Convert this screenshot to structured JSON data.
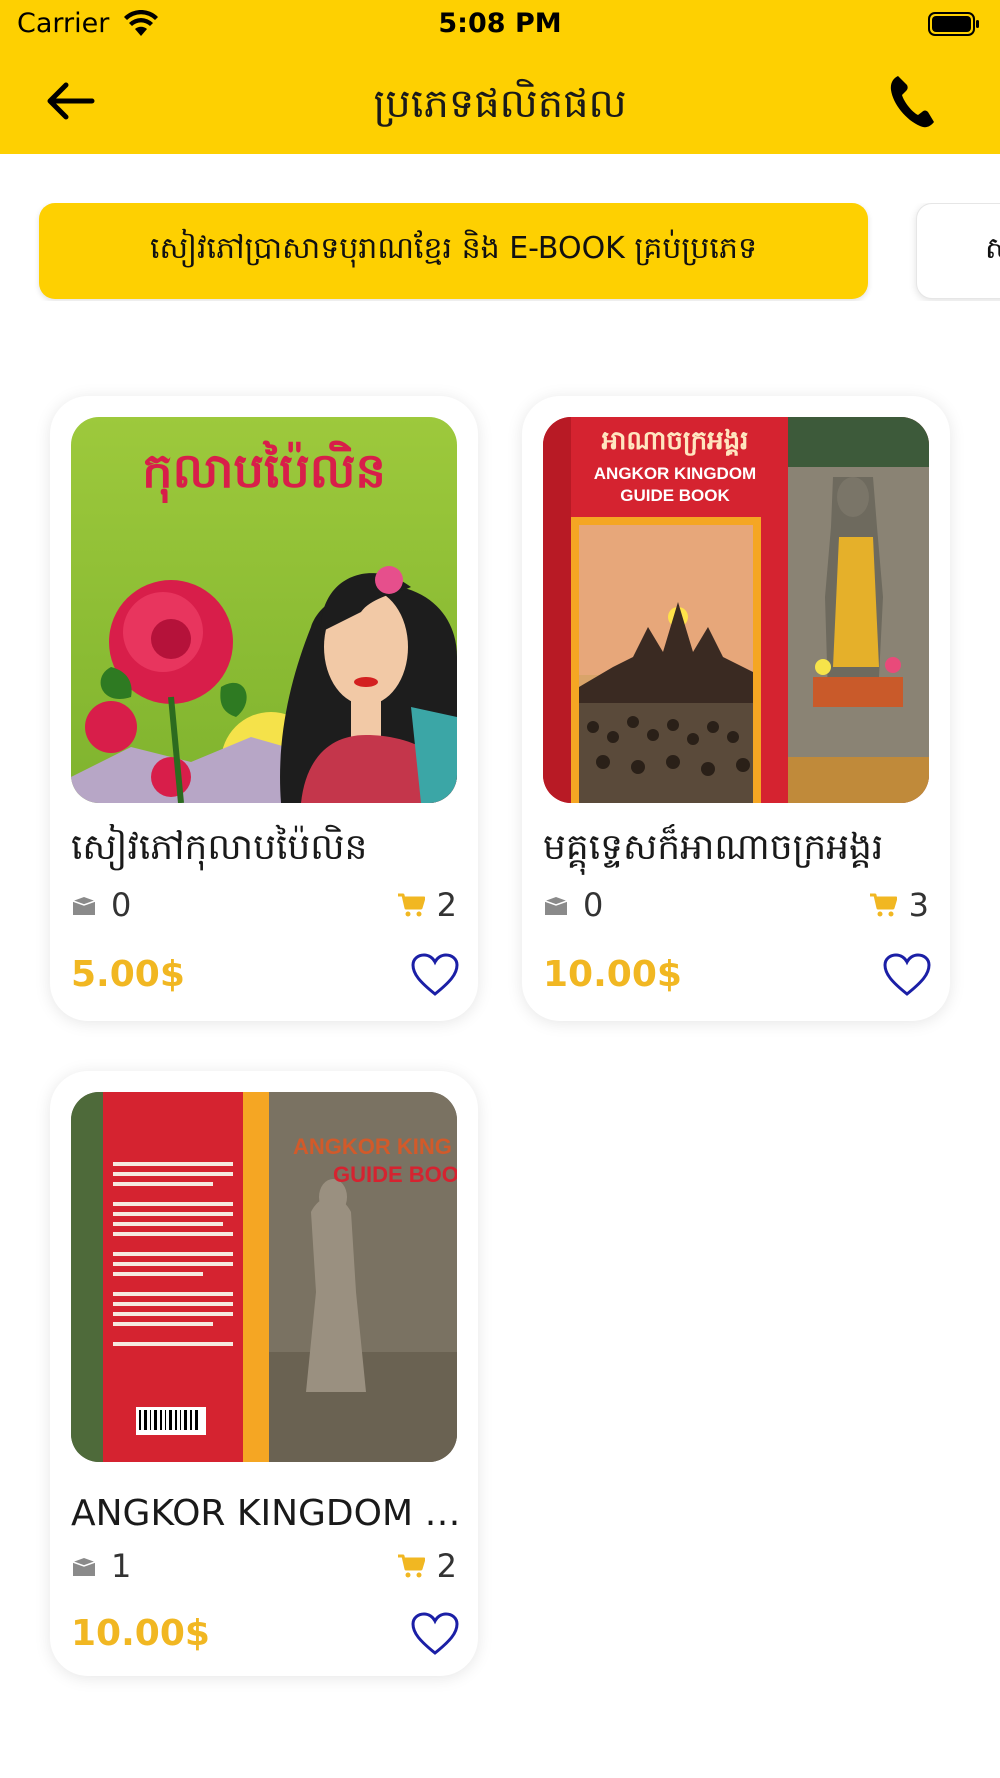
{
  "status_bar": {
    "carrier": "Carrier",
    "time": "5:08 PM"
  },
  "header": {
    "title": "ប្រភេទផលិតផល"
  },
  "categories": {
    "active_label": "សៀវភៅប្រាសាទបុរាណខ្មែរ និង E-BOOK គ្រប់ប្រភេទ",
    "next_label": "ស"
  },
  "products": [
    {
      "name": "សៀវភៅកុលាបប៉ៃលិន",
      "stock": "0",
      "sold": "2",
      "price": "5.00$",
      "cover_title": "កុលាបប៉ៃលិន"
    },
    {
      "name": "មគ្គុទ្ទេសក៏អាណាចក្រអង្គរ",
      "stock": "0",
      "sold": "3",
      "price": "10.00$",
      "cover_title": "អាណាចក្រអង្គរ",
      "cover_subtitle_1": "ANGKOR KINGDOM",
      "cover_subtitle_2": "GUIDE BOOK"
    },
    {
      "name": "ANGKOR KINGDOM G...",
      "stock": "1",
      "sold": "2",
      "price": "10.00$",
      "cover_title_1": "ANGKOR KING",
      "cover_title_2": "GUIDE BOOI"
    }
  ],
  "colors": {
    "brand_yellow": "#FED001",
    "price": "#F1B722",
    "heart": "#1B1FA6"
  }
}
